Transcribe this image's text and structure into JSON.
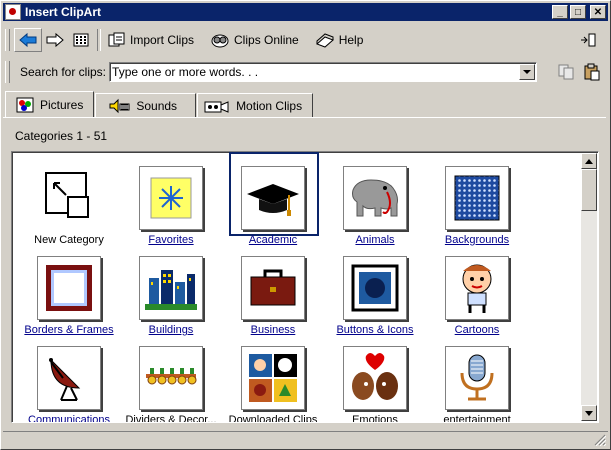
{
  "window": {
    "title": "Insert ClipArt"
  },
  "titlebar": {
    "min": "_",
    "max": "□",
    "close": "✕"
  },
  "toolbar": {
    "import_label": "Import Clips",
    "online_label": "Clips Online",
    "help_label": "Help"
  },
  "search": {
    "label": "Search for clips:",
    "placeholder": "Type one or more words. . ."
  },
  "tabs": [
    {
      "label": "Pictures",
      "active": true
    },
    {
      "label": "Sounds"
    },
    {
      "label": "Motion Clips"
    }
  ],
  "categories": {
    "count_text": "Categories 1 - 51"
  },
  "items": [
    {
      "label": "New Category",
      "icon": "new-category-icon"
    },
    {
      "label": "Favorites",
      "icon": "favorites-icon"
    },
    {
      "label": "Academic",
      "icon": "graduation-cap-icon",
      "selected": true
    },
    {
      "label": "Animals",
      "icon": "elephant-icon"
    },
    {
      "label": "Backgrounds",
      "icon": "backgrounds-icon"
    },
    {
      "label": "Borders & Frames",
      "icon": "frame-icon"
    },
    {
      "label": "Buildings",
      "icon": "buildings-icon"
    },
    {
      "label": "Business",
      "icon": "briefcase-icon"
    },
    {
      "label": "Buttons & Icons",
      "icon": "button-icon"
    },
    {
      "label": "Cartoons",
      "icon": "cartoon-icon"
    },
    {
      "label": "Communications",
      "icon": "satellite-dish-icon"
    },
    {
      "label": "Dividers & Decor...",
      "icon": "divider-icon"
    },
    {
      "label": "Downloaded Clips",
      "icon": "downloaded-clips-icon"
    },
    {
      "label": "Emotions",
      "icon": "emotions-icon"
    },
    {
      "label": "entertainment",
      "icon": "microphone-icon"
    }
  ]
}
